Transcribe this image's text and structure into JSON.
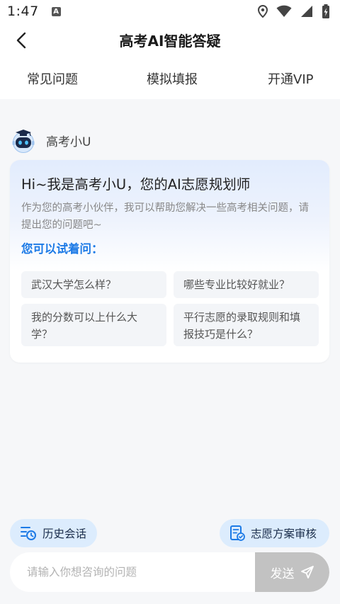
{
  "status_bar": {
    "time": "1:47",
    "notification_letter": "A"
  },
  "header": {
    "title": "高考AI智能答疑",
    "tabs": [
      "常见问题",
      "模拟填报",
      "开通VIP"
    ]
  },
  "bot": {
    "name": "高考小U"
  },
  "intro_card": {
    "title": "Hi~我是高考小U，您的AI志愿规划师",
    "description": "作为您的高考小伙伴，我可以帮助您解决一些高考相关问题，请提出您的问题吧~",
    "try_label": "您可以试着问：",
    "questions": [
      "武汉大学怎么样？",
      "哪些专业比较好就业？",
      "我的分数可以上什么大学？",
      "平行志愿的录取规则和填报技巧是什么？"
    ]
  },
  "actions": {
    "history_label": "历史会话",
    "review_label": "志愿方案审核"
  },
  "input": {
    "placeholder": "请输入你想咨询的问题",
    "send_label": "发送"
  },
  "colors": {
    "accent": "#1c7ae6",
    "pill_bg": "#dcecfd",
    "send_disabled": "#c2c2c2"
  }
}
